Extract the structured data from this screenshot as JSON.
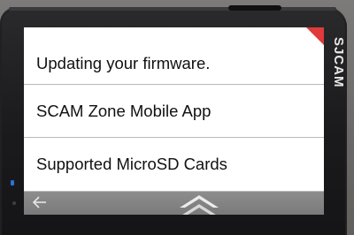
{
  "menu": {
    "items": [
      {
        "label": "Updating your firmware."
      },
      {
        "label": "SCAM Zone Mobile App"
      },
      {
        "label": "Supported MicroSD Cards"
      }
    ]
  },
  "brand": {
    "text": "SJCAM"
  },
  "navigation": {
    "back_icon": "arrow-left-icon",
    "scroll_up_icon": "double-chevron-up-icon"
  },
  "colors": {
    "accent": "#e03a3a",
    "screen_bg": "#ffffff",
    "nav_bar": "#858585",
    "led": "#2f6fd8"
  }
}
